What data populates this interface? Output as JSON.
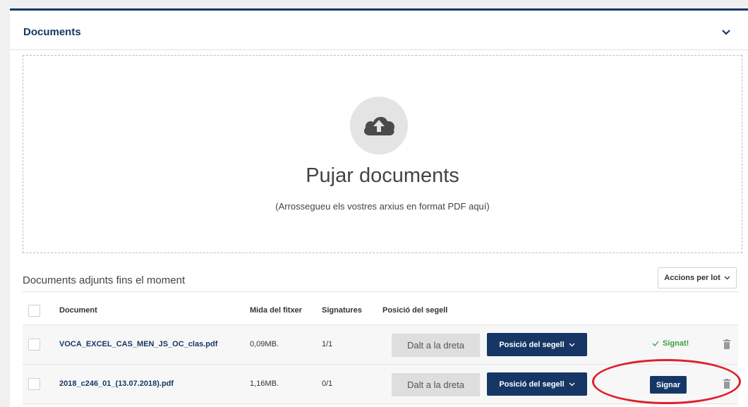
{
  "panel": {
    "title": "Documents",
    "toggle_icon": "chevron-down-icon"
  },
  "upload": {
    "icon": "cloud-upload-icon",
    "title": "Pujar documents",
    "hint": "(Arrossegueu els vostres arxius en format PDF aquí)"
  },
  "attached": {
    "section_title": "Documents adjunts fins el moment",
    "batch_label": "Accions per lot"
  },
  "table": {
    "headers": {
      "document": "Document",
      "size": "Mida del fitxer",
      "signatures": "Signatures",
      "seal_position": "Posició del segell"
    },
    "rows": [
      {
        "name": "VOCA_EXCEL_CAS_MEN_JS_OC_clas.pdf",
        "size": "0,09MB.",
        "signatures": "1/1",
        "position": "Dalt a la dreta",
        "position_button": "Posició del segell",
        "status": "Signat!"
      },
      {
        "name": "2018_c246_01_(13.07.2018).pdf",
        "size": "1,16MB.",
        "signatures": "0/1",
        "position": "Dalt a la dreta",
        "position_button": "Posició del segell",
        "sign_button": "Signar"
      }
    ]
  },
  "colors": {
    "brand": "#163766",
    "success": "#3aa040",
    "highlight": "#e02028"
  }
}
